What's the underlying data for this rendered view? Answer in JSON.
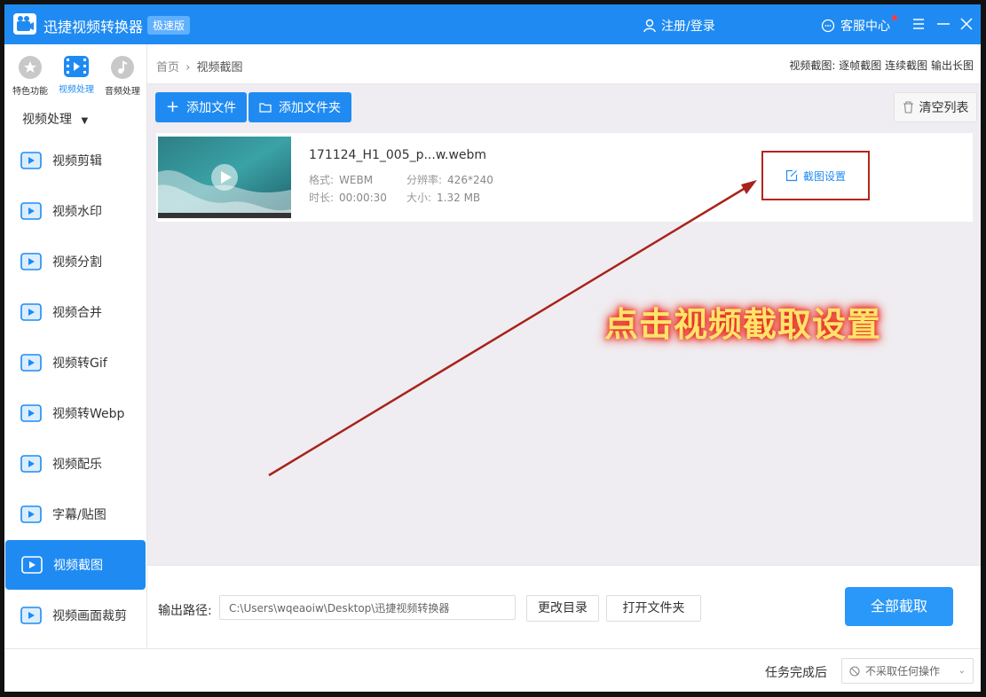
{
  "app": {
    "title": "迅捷视频转换器",
    "edition": "极速版"
  },
  "header": {
    "login": "注册/登录",
    "service": "客服中心"
  },
  "sidebar": {
    "categories": [
      {
        "label": "特色功能",
        "icon": "star-icon"
      },
      {
        "label": "视频处理",
        "icon": "film-icon"
      },
      {
        "label": "音频处理",
        "icon": "music-icon"
      }
    ],
    "dropdown": "视频处理",
    "items": [
      {
        "label": "视频剪辑"
      },
      {
        "label": "视频水印"
      },
      {
        "label": "视频分割"
      },
      {
        "label": "视频合并"
      },
      {
        "label": "视频转Gif"
      },
      {
        "label": "视频转Webp"
      },
      {
        "label": "视频配乐"
      },
      {
        "label": "字幕/贴图"
      },
      {
        "label": "视频截图"
      },
      {
        "label": "视频画面裁剪"
      }
    ],
    "active_item": "视频截图"
  },
  "breadcrumb": {
    "home": "首页",
    "sep": "›",
    "current": "视频截图"
  },
  "modes": {
    "label": "视频截图:",
    "opt1": "逐帧截图",
    "opt2": "连续截图",
    "opt3": "输出长图"
  },
  "toolbar": {
    "add_file": "添加文件",
    "add_folder": "添加文件夹",
    "clear": "清空列表"
  },
  "file": {
    "name": "171124_H1_005_p...w.webm",
    "format_label": "格式:",
    "format": "WEBM",
    "resolution_label": "分辨率:",
    "resolution": "426*240",
    "duration_label": "时长:",
    "duration": "00:00:30",
    "size_label": "大小:",
    "size": "1.32 MB",
    "settings": "截图设置"
  },
  "annotation": "点击视频截取设置",
  "output": {
    "label": "输出路径:",
    "path": "C:\\Users\\wqeaoiw\\Desktop\\迅捷视频转换器",
    "change_dir": "更改目录",
    "open_folder": "打开文件夹",
    "start_all": "全部截取"
  },
  "status": {
    "after_label": "任务完成后",
    "after_value": "不采取任何操作"
  },
  "colors": {
    "primary": "#1f8bf2",
    "highlight_border": "#b3251c",
    "annotation_text": "#ffe36a"
  }
}
